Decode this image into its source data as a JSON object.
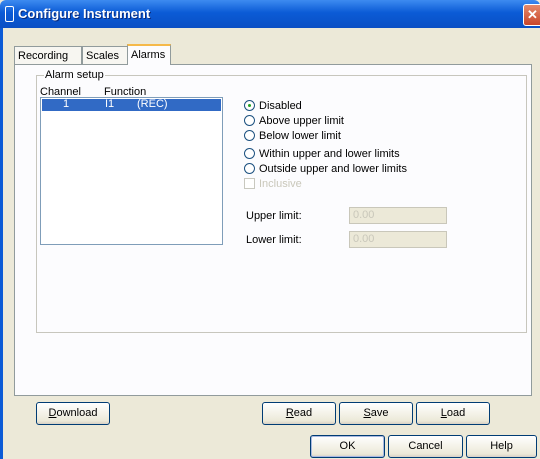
{
  "window": {
    "title": "Configure Instrument",
    "close_glyph": "✕"
  },
  "tabs": [
    {
      "label": "Recording"
    },
    {
      "label": "Scales"
    },
    {
      "label": "Alarms",
      "active": true
    }
  ],
  "alarm_setup": {
    "group_label": "Alarm setup",
    "columns": [
      "Channel",
      "Function"
    ],
    "rows": [
      {
        "channel": "1",
        "function": "I1",
        "tag": "(REC)",
        "selected": true
      }
    ]
  },
  "alarm_mode": {
    "options": [
      {
        "label": "Disabled",
        "checked": true
      },
      {
        "label": "Above upper limit",
        "checked": false
      },
      {
        "label": "Below lower limit",
        "checked": false
      },
      {
        "label": "Within upper and lower limits",
        "checked": false
      },
      {
        "label": "Outside upper and lower limits",
        "checked": false
      }
    ],
    "inclusive_label": "Inclusive"
  },
  "limits": {
    "upper_label": "Upper limit:",
    "upper_value": "0.00",
    "lower_label": "Lower limit:",
    "lower_value": "0.00"
  },
  "buttons": {
    "download": {
      "pre": "",
      "key": "D",
      "post": "ownload"
    },
    "read": {
      "pre": "",
      "key": "R",
      "post": "ead"
    },
    "save": {
      "pre": "",
      "key": "S",
      "post": "ave"
    },
    "load": {
      "pre": "",
      "key": "L",
      "post": "oad"
    },
    "ok": "OK",
    "cancel": "Cancel",
    "help": "Help"
  }
}
